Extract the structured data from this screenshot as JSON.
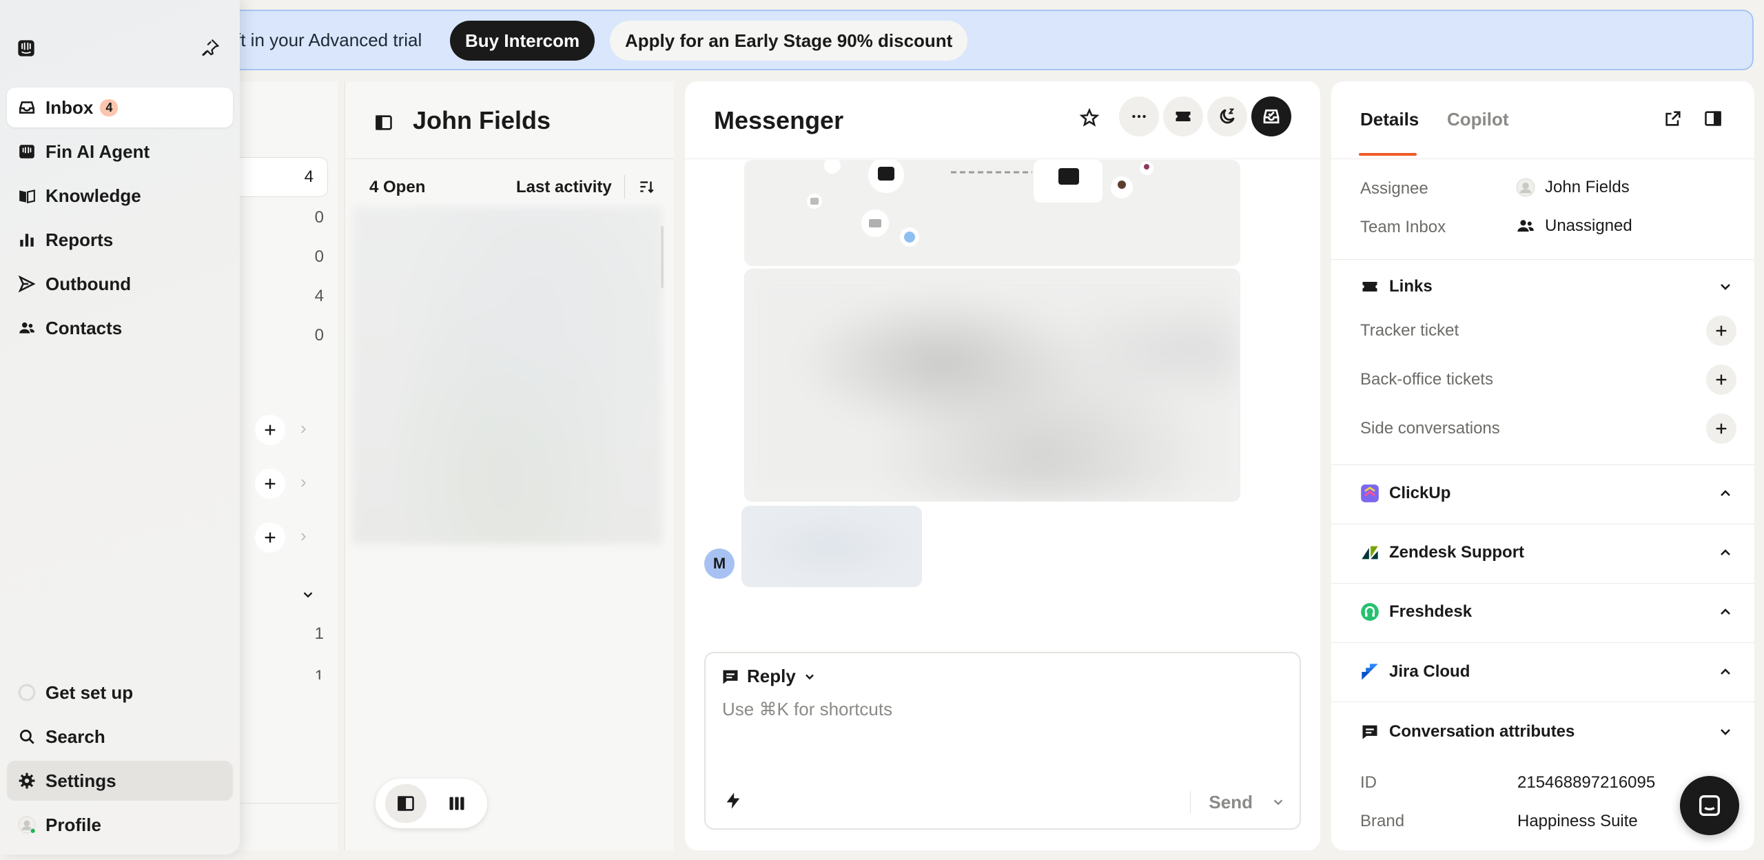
{
  "banner": {
    "trial_text": "ft in your Advanced trial",
    "buy_label": "Buy Intercom",
    "discount_label": "Apply for an Early Stage 90% discount"
  },
  "sidebar": {
    "items": [
      {
        "label": "Inbox",
        "badge": "4",
        "icon": "inbox-icon"
      },
      {
        "label": "Fin AI Agent",
        "icon": "fin-icon"
      },
      {
        "label": "Knowledge",
        "icon": "book-icon"
      },
      {
        "label": "Reports",
        "icon": "bar-chart-icon"
      },
      {
        "label": "Outbound",
        "icon": "send-icon"
      },
      {
        "label": "Contacts",
        "icon": "people-icon"
      }
    ],
    "bottom": [
      {
        "label": "Get set up",
        "icon": "progress-icon"
      },
      {
        "label": "Search",
        "icon": "search-icon"
      },
      {
        "label": "Settings",
        "icon": "gear-icon"
      },
      {
        "label": "Profile",
        "icon": "avatar-icon"
      }
    ]
  },
  "inboxes": {
    "counts": [
      "4",
      "0",
      "0",
      "4",
      "0"
    ],
    "group_counts": [
      "1",
      "1"
    ]
  },
  "list": {
    "title": "John Fields",
    "open_label": "4 Open",
    "sort_label": "Last activity"
  },
  "conversation": {
    "title": "Messenger",
    "avatar_initial": "M",
    "reply_label": "Reply",
    "composer_placeholder": "Use ⌘K for shortcuts",
    "send_label": "Send"
  },
  "details": {
    "tabs": [
      "Details",
      "Copilot"
    ],
    "assignee_label": "Assignee",
    "assignee_value": "John Fields",
    "team_label": "Team Inbox",
    "team_value": "Unassigned",
    "links_title": "Links",
    "links": [
      "Tracker ticket",
      "Back-office tickets",
      "Side conversations"
    ],
    "apps": [
      "ClickUp",
      "Zendesk Support",
      "Freshdesk",
      "Jira Cloud"
    ],
    "attributes_title": "Conversation attributes",
    "attributes": [
      {
        "label": "ID",
        "value": "215468897216095"
      },
      {
        "label": "Brand",
        "value": "Happiness Suite"
      }
    ]
  },
  "colors": {
    "accent": "#f15a29",
    "banner_bg": "#d9e6fb",
    "badge_bg": "#fbc6ad"
  }
}
